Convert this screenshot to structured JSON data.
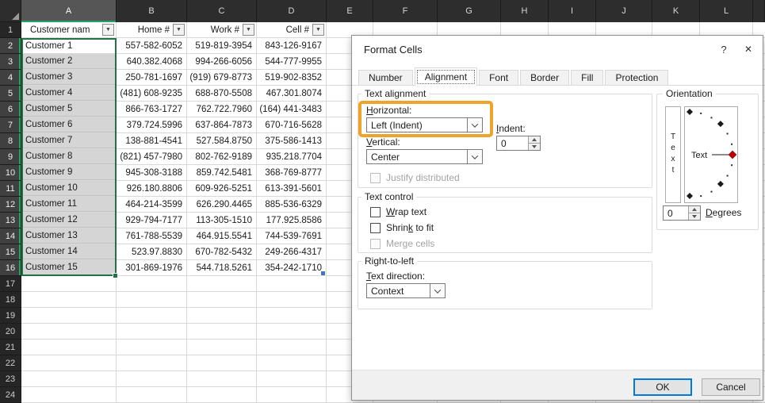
{
  "colors": {
    "selection_green": "#217346",
    "header_green": "#21a366",
    "highlight_orange": "#EFA32B",
    "ok_blue": "#0078D7"
  },
  "sheet": {
    "column_letters": [
      "A",
      "B",
      "C",
      "D",
      "E",
      "F",
      "G",
      "H",
      "I",
      "J",
      "K",
      "L"
    ],
    "row_numbers": [
      1,
      2,
      3,
      4,
      5,
      6,
      7,
      8,
      9,
      10,
      11,
      12,
      13,
      14,
      15,
      16,
      17,
      18,
      19,
      20,
      21,
      22,
      23,
      24
    ],
    "table": {
      "filter_glyph": "▼",
      "headers": [
        "Customer nam",
        "Home #",
        "Work #",
        "Cell #"
      ],
      "rows": [
        [
          "Customer 1",
          "557-582-6052",
          "519-819-3954",
          "843-126-9167"
        ],
        [
          "Customer 2",
          "640.382.4068",
          "994-266-6056",
          "544-777-9955"
        ],
        [
          "Customer 3",
          "250-781-1697",
          "(919) 679-8773",
          "519-902-8352"
        ],
        [
          "Customer 4",
          "(481) 608-9235",
          "688-870-5508",
          "467.301.8074"
        ],
        [
          "Customer 5",
          "866-763-1727",
          "762.722.7960",
          "(164) 441-3483"
        ],
        [
          "Customer 6",
          "379.724.5996",
          "637-864-7873",
          "670-716-5628"
        ],
        [
          "Customer 7",
          "138-881-4541",
          "527.584.8750",
          "375-586-1413"
        ],
        [
          "Customer 8",
          "(821) 457-7980",
          "802-762-9189",
          "935.218.7704"
        ],
        [
          "Customer 9",
          "945-308-3188",
          "859.742.5481",
          "368-769-8777"
        ],
        [
          "Customer 10",
          "926.180.8806",
          "609-926-5251",
          "613-391-5601"
        ],
        [
          "Customer 11",
          "464-214-3599",
          "626.290.4465",
          "885-536-6329"
        ],
        [
          "Customer 12",
          "929-794-7177",
          "113-305-1510",
          "177.925.8586"
        ],
        [
          "Customer 13",
          "761-788-5539",
          "464.915.5541",
          "744-539-7691"
        ],
        [
          "Customer 14",
          "523.97.8830",
          "670-782-5432",
          "249-266-4317"
        ],
        [
          "Customer 15",
          "301-869-1976",
          "544.718.5261",
          "354-242-1710"
        ]
      ]
    }
  },
  "dialog": {
    "title": "Format Cells",
    "help_glyph": "?",
    "close_glyph": "✕",
    "tabs": [
      "Number",
      "Alignment",
      "Font",
      "Border",
      "Fill",
      "Protection"
    ],
    "active_tab": "Alignment",
    "text_alignment": {
      "legend": "Text alignment",
      "horizontal_label": "Horizontal:",
      "horizontal_value": "Left (Indent)",
      "indent_label": "Indent:",
      "indent_value": "0",
      "vertical_label": "Vertical:",
      "vertical_value": "Center",
      "justify": {
        "label": "Justify distributed",
        "checked": false,
        "disabled": true
      }
    },
    "text_control": {
      "legend": "Text control",
      "options": [
        {
          "label": "Wrap text",
          "checked": false,
          "disabled": false
        },
        {
          "label": "Shrink to fit",
          "checked": false,
          "disabled": false
        },
        {
          "label": "Merge cells",
          "checked": false,
          "disabled": true
        }
      ]
    },
    "right_to_left": {
      "legend": "Right-to-left",
      "text_direction_label": "Text direction:",
      "text_direction_value": "Context"
    },
    "orientation": {
      "legend": "Orientation",
      "text_label": "Text",
      "degrees_value": "0",
      "degrees_label": "Degrees"
    },
    "buttons": {
      "ok": "OK",
      "cancel": "Cancel"
    }
  }
}
